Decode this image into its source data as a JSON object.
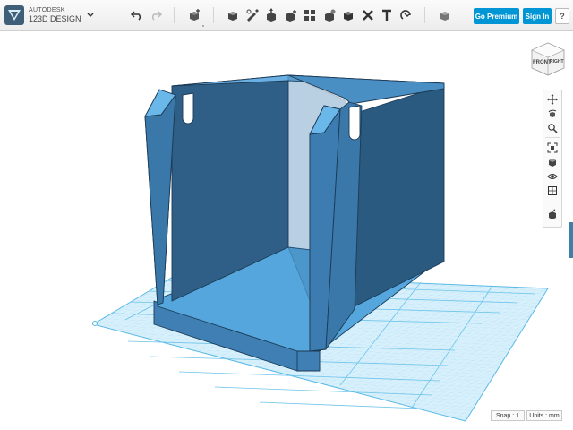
{
  "app": {
    "brand_line1": "AUTODESK",
    "brand_line2": "123D DESIGN"
  },
  "toolbar": {
    "tools": [
      {
        "name": "undo-icon"
      },
      {
        "name": "redo-icon"
      },
      {
        "name": "transform-icon"
      },
      {
        "name": "primitives-icon"
      },
      {
        "name": "sketch-icon"
      },
      {
        "name": "construct-icon"
      },
      {
        "name": "modify-icon"
      },
      {
        "name": "pattern-icon"
      },
      {
        "name": "group-icon"
      },
      {
        "name": "combine-icon"
      },
      {
        "name": "measure-icon"
      },
      {
        "name": "text-icon"
      },
      {
        "name": "snap-icon"
      },
      {
        "name": "material-icon"
      }
    ],
    "go_premium_label": "Go Premium",
    "sign_in_label": "Sign In",
    "help_label": "?"
  },
  "viewcube": {
    "front_label": "FRONT",
    "right_label": "RIGHT"
  },
  "status_bar": {
    "snap_label": "Snap : 1",
    "units_label": "Units : mm"
  },
  "colors": {
    "model_face": "#4a8fc4",
    "model_dark": "#2e5f85",
    "grid_line": "#8fd0ef",
    "accent": "#0096d6"
  }
}
